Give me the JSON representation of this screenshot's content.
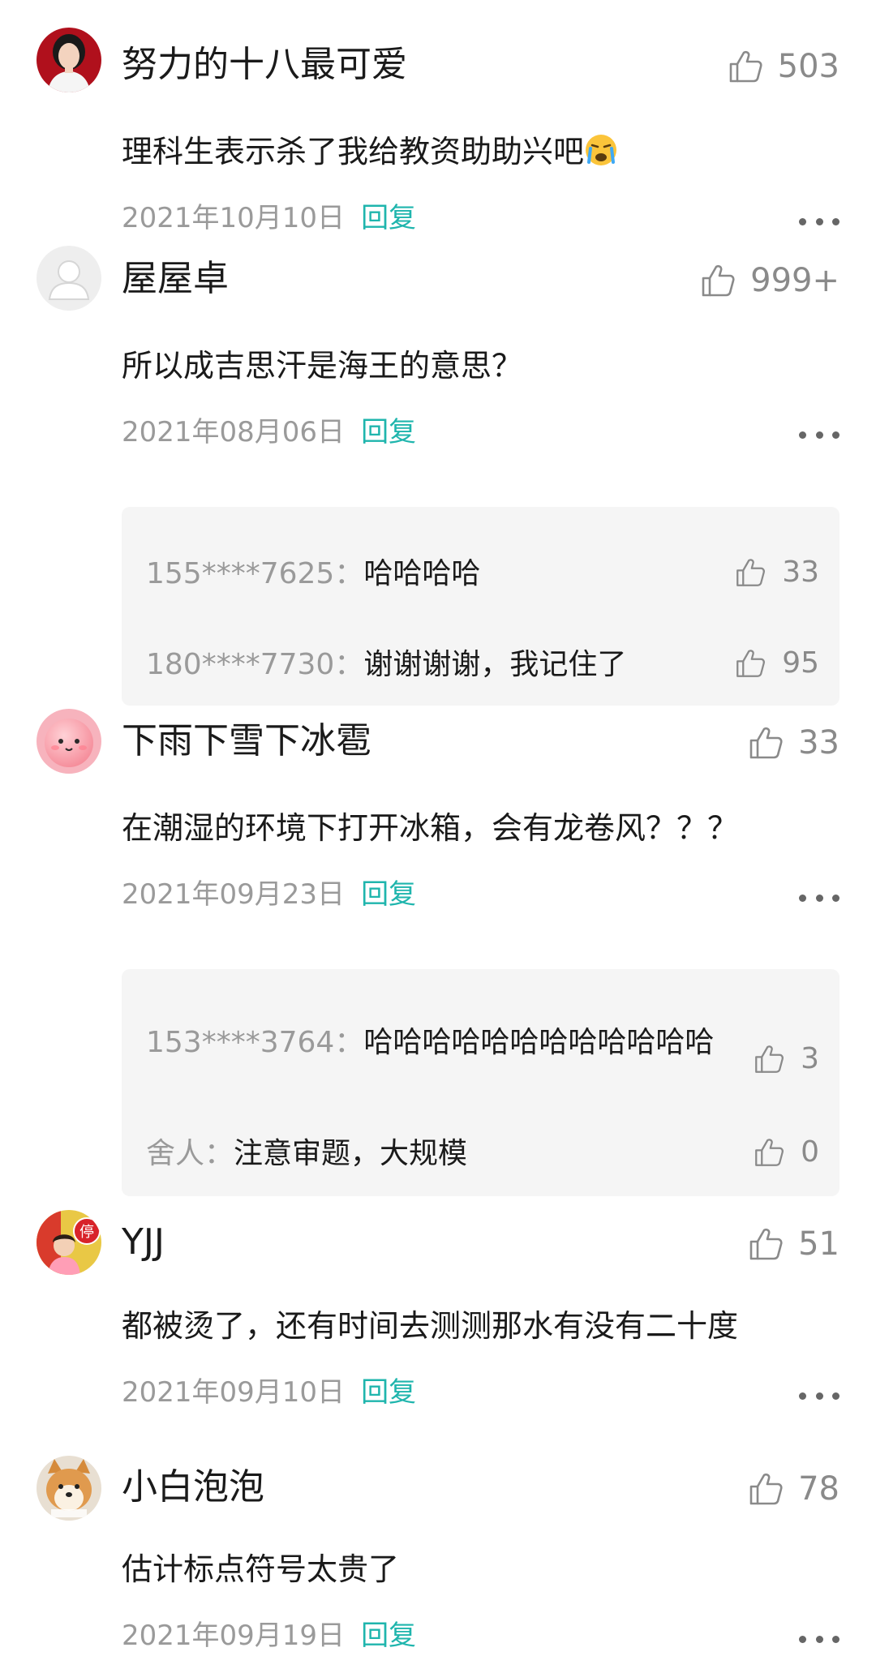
{
  "comments": [
    {
      "username": "努力的十八最可爱",
      "likes": "503",
      "content": "理科生表示杀了我给教资助助兴吧",
      "content_emoji": "crying-face",
      "date": "2021年10月10日",
      "reply_label": "回复",
      "avatar": "woman-portrait"
    },
    {
      "username": "屋屋卓",
      "likes": "999+",
      "content": "所以成吉思汗是海王的意思？",
      "date": "2021年08月06日",
      "reply_label": "回复",
      "avatar": "default-user",
      "replies": [
        {
          "name": "155****7625：",
          "text": "哈哈哈哈",
          "likes": "33"
        },
        {
          "name": "180****7730：",
          "text": "谢谢谢谢，我记住了",
          "likes": "95"
        }
      ]
    },
    {
      "username": "下雨下雪下冰雹",
      "likes": "33",
      "content": "在潮湿的环境下打开冰箱，会有龙卷风？？？",
      "date": "2021年09月23日",
      "reply_label": "回复",
      "avatar": "pink-blob",
      "replies": [
        {
          "name": "153****3764：",
          "text": "哈哈哈哈哈哈哈哈哈哈哈哈",
          "likes": "3"
        },
        {
          "name": "舍人：",
          "text": "注意审题，大规模",
          "likes": "0"
        }
      ]
    },
    {
      "username": "YJJ",
      "likes": "51",
      "content": "都被烫了，还有时间去测测那水有没有二十度",
      "date": "2021年09月10日",
      "reply_label": "回复",
      "avatar": "child-stop-sign",
      "avatar_text": "停"
    },
    {
      "username": "小白泡泡",
      "likes": "78",
      "content": "估计标点符号太贵了",
      "date": "2021年09月19日",
      "reply_label": "回复",
      "avatar": "shiba-dog"
    }
  ],
  "colors": {
    "reply_accent": "#1fb5ad",
    "meta_gray": "#9a9a9a",
    "reply_box_bg": "#f5f5f5"
  },
  "icons": [
    "thumbs-up-icon",
    "more-dots-icon"
  ]
}
